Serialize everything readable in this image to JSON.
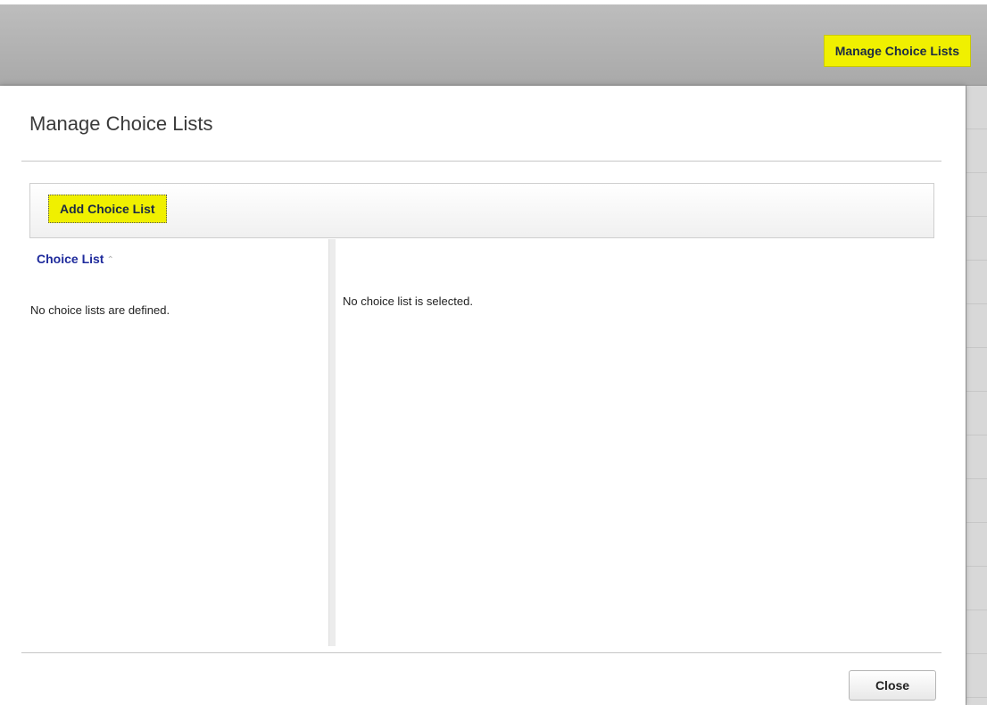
{
  "header": {
    "manage_button_label": "Manage Choice Lists"
  },
  "dialog": {
    "title": "Manage Choice Lists",
    "toolbar": {
      "add_button_label": "Add Choice List"
    },
    "left_panel": {
      "column_header": "Choice List",
      "sort_icon": "sort-ascending-icon",
      "empty_message": "No choice lists are defined."
    },
    "right_panel": {
      "empty_message": "No choice list is selected."
    },
    "footer": {
      "close_button_label": "Close"
    }
  },
  "colors": {
    "highlight": "#f0f000",
    "link": "#1f2b9c",
    "topbar": "#b3b3b3"
  }
}
